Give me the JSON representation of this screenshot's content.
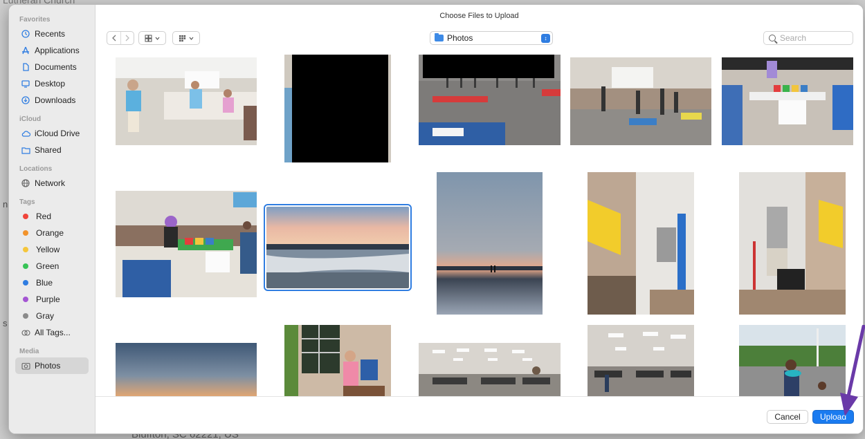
{
  "background": {
    "top_text": "Lutheran Church",
    "bottom_text": "Bluffton, SC 62221, US",
    "edge_n": "n",
    "edge_s": "s"
  },
  "dialog": {
    "title": "Choose Files to Upload",
    "location": "Photos",
    "search_placeholder": "Search",
    "cancel_label": "Cancel",
    "upload_label": "Upload"
  },
  "sidebar": {
    "favorites_header": "Favorites",
    "favorites": [
      {
        "label": "Recents",
        "icon": "clock-icon"
      },
      {
        "label": "Applications",
        "icon": "applications-icon"
      },
      {
        "label": "Documents",
        "icon": "document-icon"
      },
      {
        "label": "Desktop",
        "icon": "desktop-icon"
      },
      {
        "label": "Downloads",
        "icon": "download-icon"
      }
    ],
    "icloud_header": "iCloud",
    "icloud": [
      {
        "label": "iCloud Drive",
        "icon": "cloud-icon"
      },
      {
        "label": "Shared",
        "icon": "shared-folder-icon"
      }
    ],
    "locations_header": "Locations",
    "locations": [
      {
        "label": "Network",
        "icon": "globe-icon"
      }
    ],
    "tags_header": "Tags",
    "tags": [
      {
        "label": "Red",
        "color": "#f0443a"
      },
      {
        "label": "Orange",
        "color": "#f2932b"
      },
      {
        "label": "Yellow",
        "color": "#f5c63b"
      },
      {
        "label": "Green",
        "color": "#37c356"
      },
      {
        "label": "Blue",
        "color": "#2f7de1"
      },
      {
        "label": "Purple",
        "color": "#a455d3"
      },
      {
        "label": "Gray",
        "color": "#8a8a8a"
      }
    ],
    "all_tags": "All Tags...",
    "media_header": "Media",
    "media": [
      {
        "label": "Photos",
        "icon": "photos-icon",
        "selected": true
      }
    ]
  },
  "colors": {
    "accent": "#1a7bf0",
    "annotation_arrow": "#6a3aa8"
  }
}
